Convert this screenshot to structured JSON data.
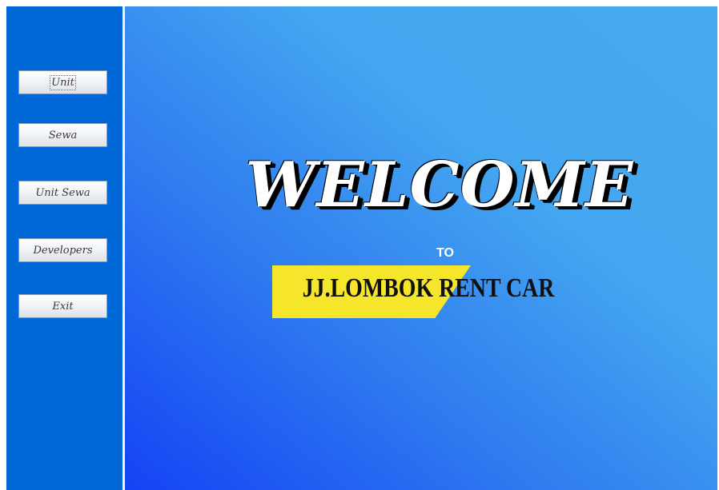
{
  "sidebar": {
    "buttons": [
      {
        "label": "Unit"
      },
      {
        "label": "Sewa"
      },
      {
        "label": "Unit Sewa"
      },
      {
        "label": "Developers"
      },
      {
        "label": "Exit"
      }
    ]
  },
  "main": {
    "welcome": "WELCOME",
    "to": "TO",
    "company": "JJ.LOMBOK RENT CAR"
  },
  "colors": {
    "sidebar_bg": "#0067d6",
    "main_gradient_start": "#1443f5",
    "main_gradient_end": "#48aaee",
    "banner_yellow": "#f5e62b"
  }
}
